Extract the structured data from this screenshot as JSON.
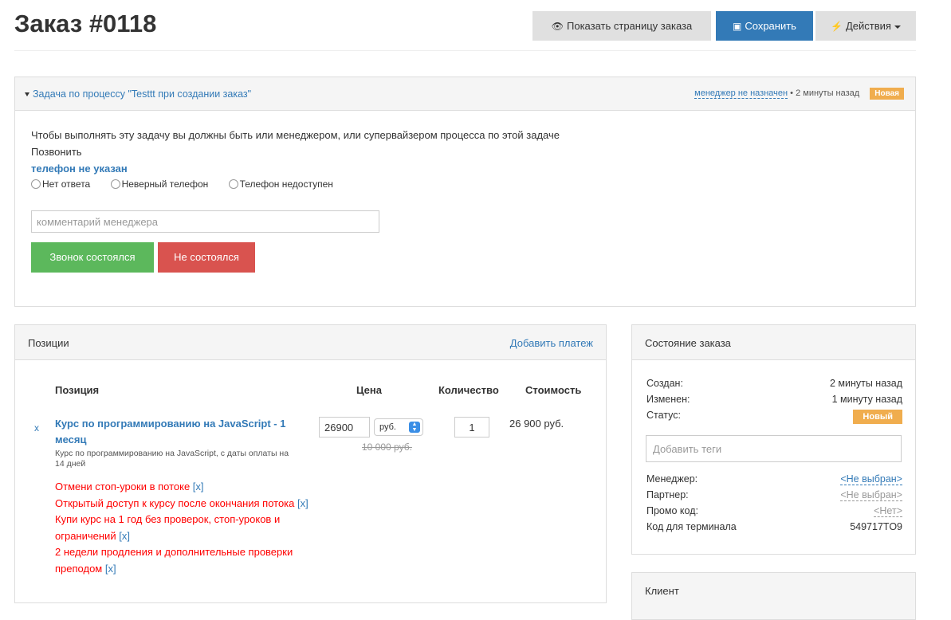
{
  "header": {
    "title": "Заказ #0118",
    "show_order_page": "Показать страницу заказа",
    "save": "Сохранить",
    "actions": "Действия"
  },
  "task": {
    "title": "Задача по процессу \"Testtt при создании заказ\"",
    "manager": "менеджер не назначен",
    "separator": "•",
    "time": "2 минуты назад",
    "status": "Новая",
    "permission_note": "Чтобы выполнять эту задачу вы должны быть или менеджером, или супервайзером процесса по этой задаче",
    "action": "Позвонить",
    "phone": "телефон не указан",
    "options": [
      "Нет ответа",
      "Неверный телефон",
      "Телефон недоступен"
    ],
    "comment_placeholder": "комментарий менеджера",
    "call_done": "Звонок состоялся",
    "call_failed": "Не состоялся",
    "colors": {
      "success": "#5cb85c",
      "danger": "#d9534f",
      "primary": "#337ab7",
      "warning": "#f0ad4e"
    }
  },
  "positions": {
    "title": "Позиции",
    "add_payment": "Добавить платеж",
    "columns": {
      "position": "Позиция",
      "price": "Цена",
      "quantity": "Количество",
      "cost": "Стоимость"
    },
    "item": {
      "remove": "x",
      "name": "Курс по программированию на JavaScript - 1 месяц",
      "description": "Курс по программированию на JavaScript, с даты оплаты на 14 дней",
      "price": "26900",
      "currency": "руб.",
      "old_price": "10 000 руб.",
      "quantity": "1",
      "cost": "26 900 руб.",
      "upsells": [
        "Отмени стоп-уроки в потоке",
        "Открытый доступ к курсу после окончания потока",
        "Купи курс на 1 год без проверок, стоп-уроков и ограничений",
        "2 недели продления и дополнительные проверки преподом"
      ],
      "upsell_remove": "[x]"
    }
  },
  "order_state": {
    "title": "Состояние заказа",
    "created_label": "Создан:",
    "created_value": "2 минуты назад",
    "changed_label": "Изменен:",
    "changed_value": "1 минуту назад",
    "status_label": "Статус:",
    "status_value": "Новый",
    "tags_placeholder": "Добавить теги",
    "manager_label": "Менеджер:",
    "manager_value": "<Не выбран>",
    "partner_label": "Партнер:",
    "partner_value": "<Не выбран>",
    "promo_label": "Промо код:",
    "promo_value": "<Нет>",
    "terminal_label": "Код для терминала",
    "terminal_value": "549717TO9"
  },
  "client": {
    "title": "Клиент"
  }
}
